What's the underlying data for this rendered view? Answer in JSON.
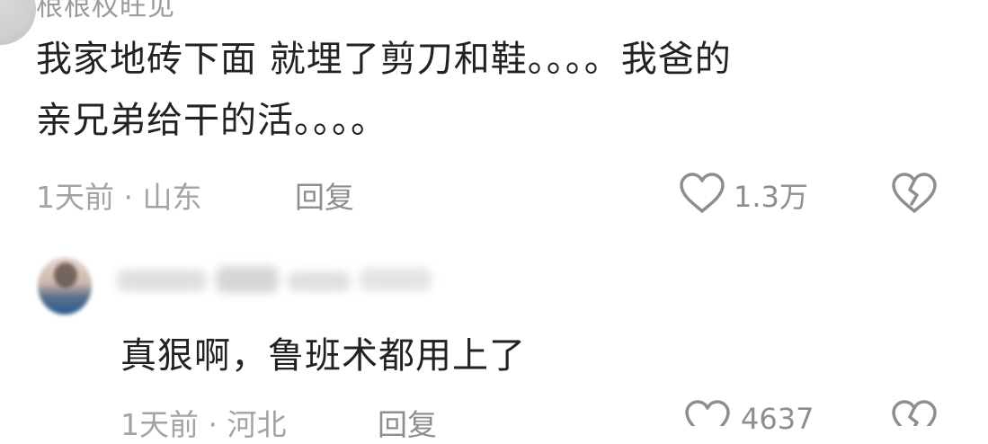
{
  "comment_top": {
    "username": "根根权旺见",
    "text_line1": "我家地砖下面 就埋了剪刀和鞋。。。。我爸的",
    "text_line2": "亲兄弟给干的活。。。。",
    "time_location": "1天前 · 山东",
    "reply_label": "回复",
    "like_count": "1.3万"
  },
  "comment_reply": {
    "username": "",
    "text": "真狠啊，鲁班术都用上了",
    "time_location": "1天前 · 河北",
    "reply_label": "回复",
    "like_count": "4637"
  },
  "icons": {
    "like": "heart-outline-icon",
    "dislike": "broken-heart-icon"
  },
  "colors": {
    "text": "#222222",
    "meta": "#a3a3a3",
    "icon": "#8e8e8e"
  }
}
